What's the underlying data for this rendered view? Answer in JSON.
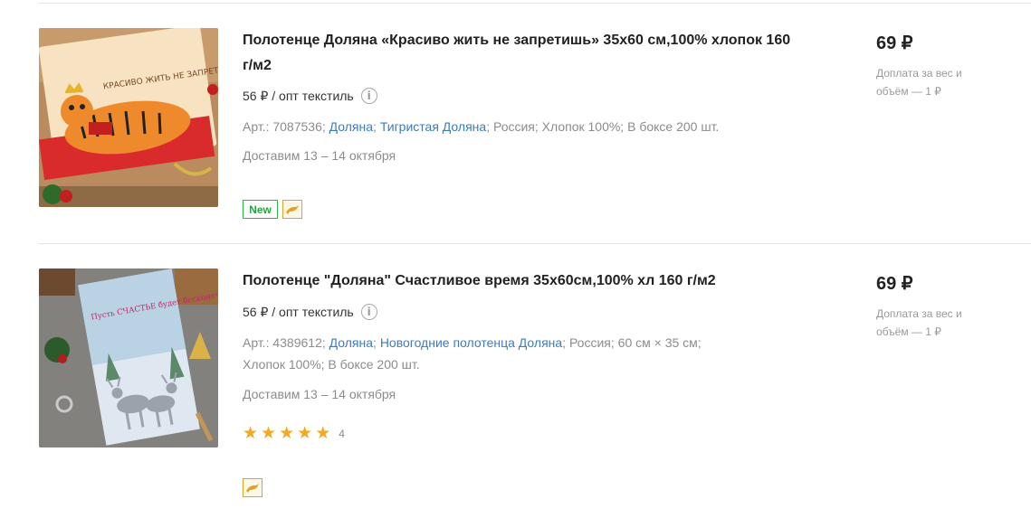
{
  "products": [
    {
      "title": "Полотенце Доляна «Красиво жить не запретишь» 35х60 см,100% хлопок 160 г/м2",
      "opt_price": "56 ₽ / опт текстиль",
      "meta": {
        "art": "Арт.: 7087536;",
        "brand": "Доляна",
        "series": "Тигристая Доляна",
        "details": [
          "Россия;",
          "Хлопок 100%;",
          "В боксе 200 шт."
        ]
      },
      "delivery": "Доставим 13 – 14 октября",
      "badge_new": "New",
      "price": "69 ₽",
      "surcharge": "Доплата за вес и объём — 1 ₽",
      "image_text": "КРАСИВО ЖИТЬ НЕ ЗАПРЕТИШЬ"
    },
    {
      "title": "Полотенце \"Доляна\" Счастливое время 35х60см,100% хл 160 г/м2",
      "opt_price": "56 ₽ / опт текстиль",
      "meta": {
        "art": "Арт.: 4389612;",
        "brand": "Доляна",
        "series": "Новогодние полотенца Доляна",
        "details": [
          "Россия;",
          "60 см × 35 см;",
          "Хлопок 100%;",
          "В боксе 200 шт."
        ]
      },
      "delivery": "Доставим 13 – 14 октября",
      "rating": 5,
      "rating_count": "4",
      "price": "69 ₽",
      "surcharge": "Доплата за вес и объём — 1 ₽",
      "image_text": "Пусть СЧАСТЬЕ будет бесконечным"
    }
  ],
  "colors": {
    "link": "#3d7bbf",
    "new_badge": "#23a53f",
    "star": "#f6a823",
    "promo_badge": "#e0a326"
  },
  "icons": {
    "info": "i",
    "star": "★",
    "promo": "dolphin-icon"
  }
}
